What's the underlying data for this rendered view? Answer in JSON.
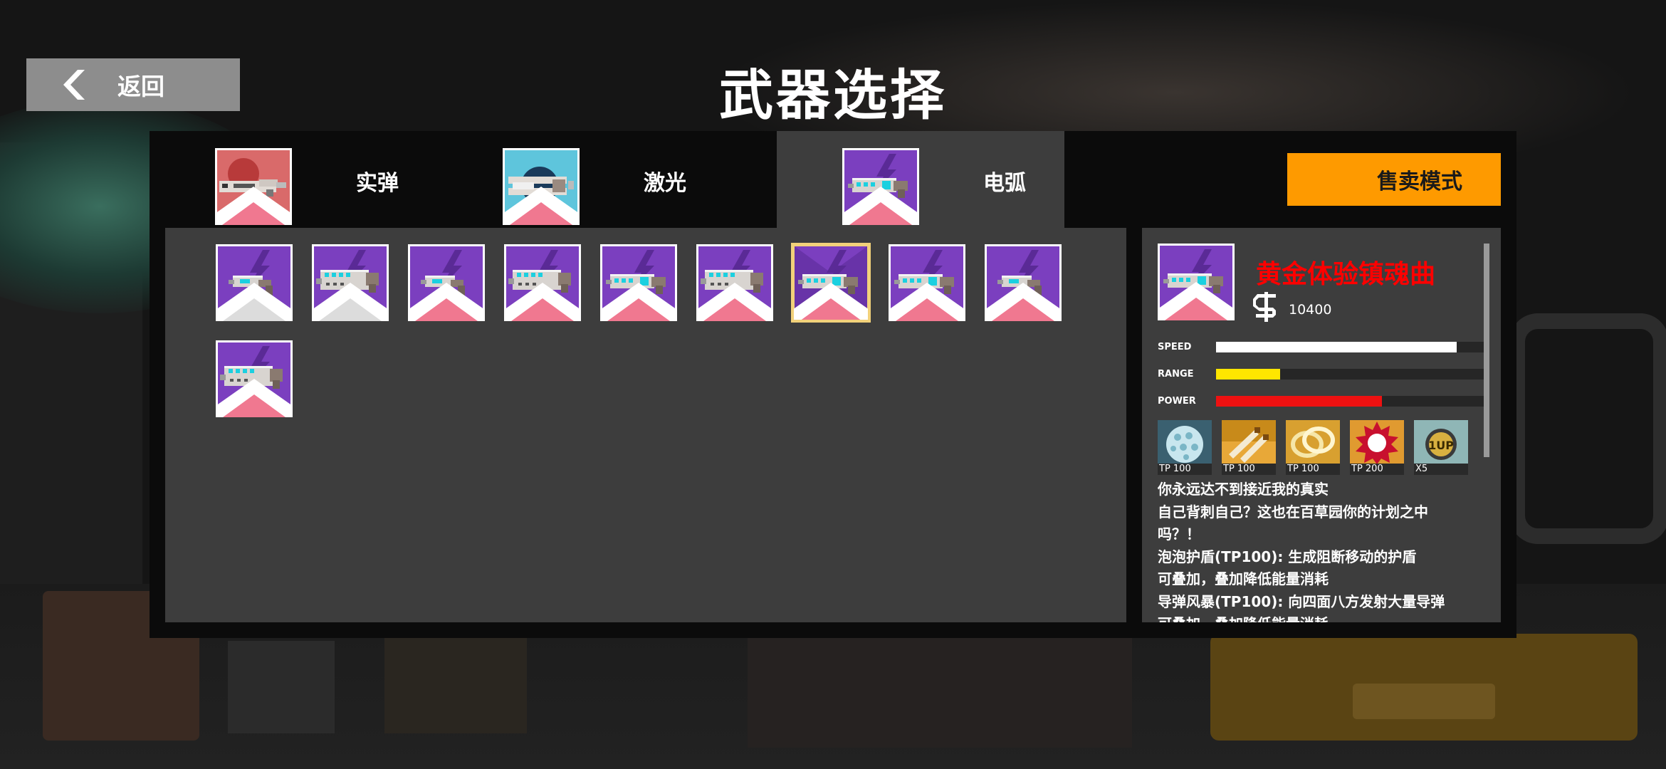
{
  "header": {
    "back_label": "返回",
    "title": "武器选择"
  },
  "tabs": [
    {
      "label": "实弹",
      "color": "#d96a6a",
      "active": false
    },
    {
      "label": "激光",
      "color": "#5ec5dc",
      "active": false
    },
    {
      "label": "电弧",
      "color": "#7b3fbf",
      "active": true
    }
  ],
  "sell_button": "售卖模式",
  "weapons": [
    {
      "variant": "small",
      "badge": "white"
    },
    {
      "variant": "large",
      "badge": "white"
    },
    {
      "variant": "small",
      "badge": "pink"
    },
    {
      "variant": "large",
      "badge": "pink"
    },
    {
      "variant": "medium",
      "badge": "pink"
    },
    {
      "variant": "large",
      "badge": "pink"
    },
    {
      "variant": "medium",
      "badge": "pink",
      "selected": true
    },
    {
      "variant": "medium",
      "badge": "pink"
    },
    {
      "variant": "small",
      "badge": "pink"
    },
    {
      "variant": "large",
      "badge": "pink"
    }
  ],
  "detail": {
    "name": "黄金体验镇魂曲",
    "price": "10400",
    "stats": [
      {
        "label": "SPEED",
        "value": 0.9,
        "color": "#ffffff"
      },
      {
        "label": "RANGE",
        "value": 0.24,
        "color": "#ffe600"
      },
      {
        "label": "POWER",
        "value": 0.62,
        "color": "#ee1111"
      }
    ],
    "skills": [
      {
        "icon": "bubble-shield-icon",
        "cost": "TP 100"
      },
      {
        "icon": "missile-storm-icon",
        "cost": "TP 100"
      },
      {
        "icon": "gold-rings-icon",
        "cost": "TP 100"
      },
      {
        "icon": "spiked-orb-icon",
        "cost": "TP 200"
      },
      {
        "icon": "one-up-coin-icon",
        "cost": "X5"
      }
    ],
    "description": [
      "你永远达不到接近我的真实",
      "自己背刺自己？这也在百草园你的计划之中",
      "吗？！",
      "泡泡护盾(TP100): 生成阻断移动的护盾",
      "可叠加，叠加降低能量消耗",
      "导弹风暴(TP100): 向四面八方发射大量导弹",
      "可叠加，叠加降低能量消耗"
    ]
  }
}
